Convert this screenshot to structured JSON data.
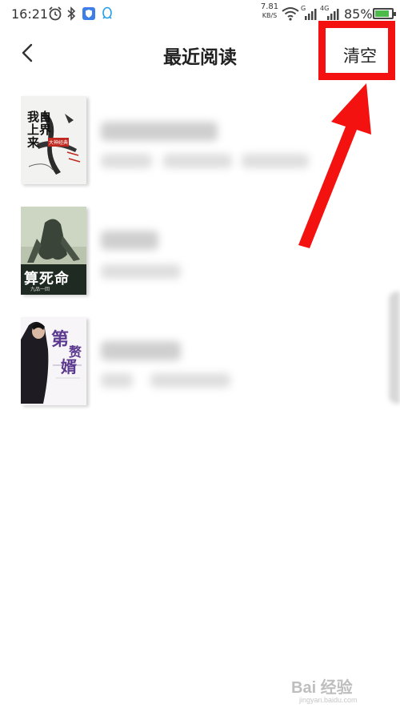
{
  "status_bar": {
    "time": "16:21",
    "net_speed_value": "7.81",
    "net_speed_unit": "KB/S",
    "signal_g": "G",
    "signal_4g": "4G",
    "battery_percent": "85%",
    "battery_level": 0.85
  },
  "header": {
    "title": "最近阅读",
    "clear_label": "清空"
  },
  "books": [
    {
      "cover_title": "我自上界来",
      "cover_tag": "大神经典"
    },
    {
      "cover_title": "算死命",
      "cover_author": "九品一回"
    },
    {
      "cover_title": "第一赘婿",
      "cover_line1": "第",
      "cover_line2": "赘",
      "cover_line3": "婿"
    }
  ],
  "annotation": {
    "color": "#f3120f"
  },
  "watermark": {
    "text": "Bai 经验",
    "url": "jingyan.baidu.com"
  }
}
